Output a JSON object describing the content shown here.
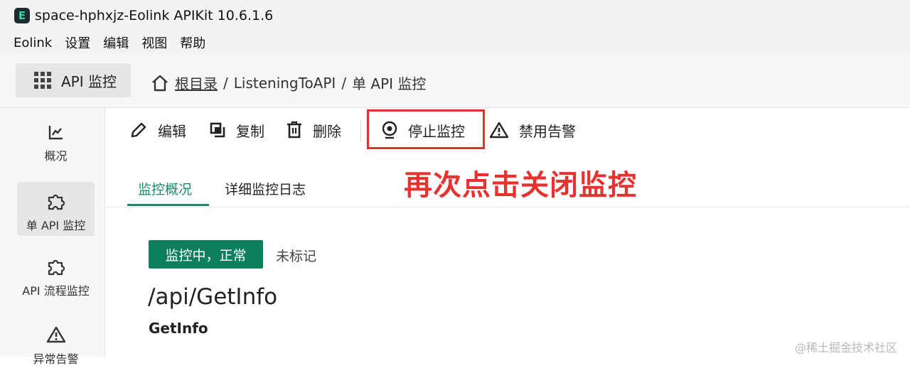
{
  "window": {
    "title": "space-hphxjz-Eolink APIKit 10.6.1.6",
    "logo_letter": "E"
  },
  "menu": {
    "items": [
      "Eolink",
      "设置",
      "编辑",
      "视图",
      "帮助"
    ]
  },
  "topnav": {
    "module_label": "API 监控",
    "breadcrumb": {
      "root": "根目录",
      "separator": "/",
      "items": [
        "ListeningToAPI",
        "单 API 监控"
      ]
    }
  },
  "sidebar": {
    "items": [
      {
        "label": "概况",
        "icon": "chart-icon"
      },
      {
        "label": "单 API 监控",
        "icon": "puzzle-icon",
        "active": true
      },
      {
        "label": "API 流程监控",
        "icon": "puzzle-icon"
      },
      {
        "label": "异常告警",
        "icon": "warning-icon"
      }
    ]
  },
  "toolbar": {
    "edit": "编辑",
    "copy": "复制",
    "delete": "删除",
    "stop_monitor": "停止监控",
    "disable_alert": "禁用告警"
  },
  "annotation": {
    "text": "再次点击关闭监控",
    "color": "#e8322f"
  },
  "tabs": [
    {
      "label": "监控概况",
      "active": true
    },
    {
      "label": "详细监控日志"
    }
  ],
  "detail": {
    "status": "监控中，正常",
    "tag": "未标记",
    "api_path": "/api/GetInfo",
    "api_name": "GetInfo"
  },
  "watermark": "@稀土掘金技术社区",
  "colors": {
    "accent": "#1c8a67",
    "status_bg": "#0d7f5d",
    "highlight": "#e0312f"
  }
}
